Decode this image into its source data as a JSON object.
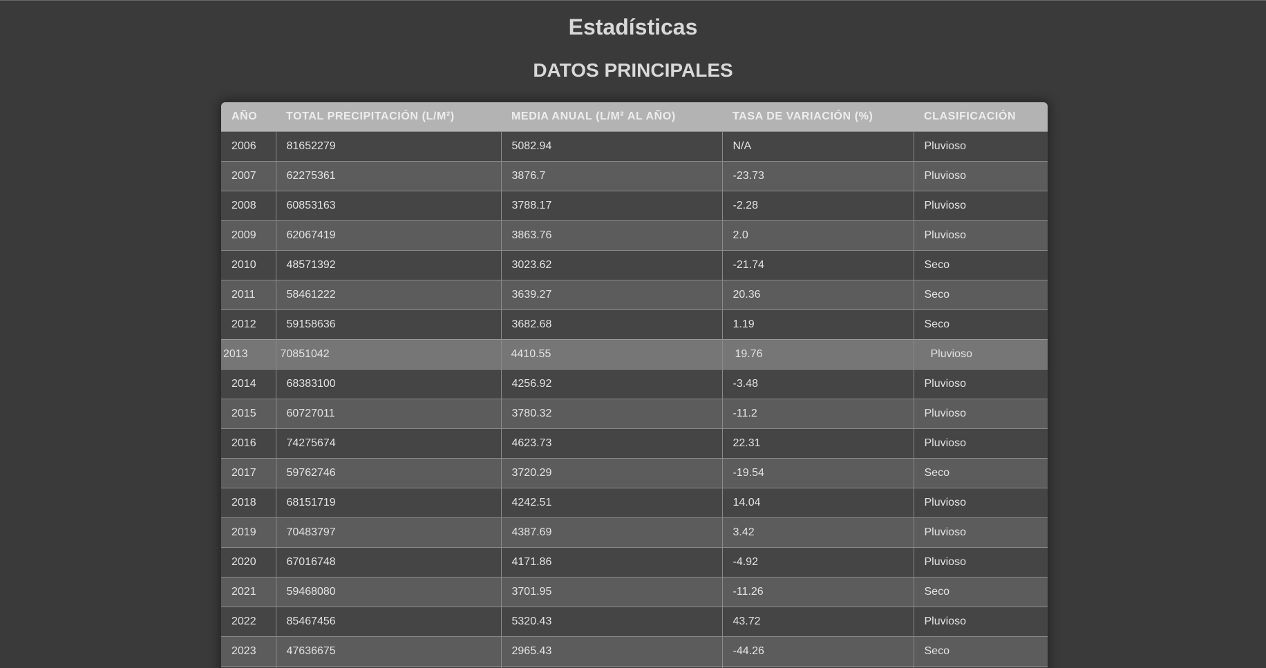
{
  "page": {
    "title": "Estadísticas",
    "subtitle": "DATOS PRINCIPALES"
  },
  "table": {
    "headers": [
      "AÑO",
      "TOTAL PRECIPITACIÓN (L/M²)",
      "MEDIA ANUAL (L/M² AL AÑO)",
      "TASA DE VARIACIÓN (%)",
      "CLASIFICACIÓN"
    ],
    "highlighted_row_year": "2013",
    "rows": [
      [
        "2006",
        "81652279",
        "5082.94",
        "N/A",
        "Pluvioso"
      ],
      [
        "2007",
        "62275361",
        "3876.7",
        "-23.73",
        "Pluvioso"
      ],
      [
        "2008",
        "60853163",
        "3788.17",
        "-2.28",
        "Pluvioso"
      ],
      [
        "2009",
        "62067419",
        "3863.76",
        "2.0",
        "Pluvioso"
      ],
      [
        "2010",
        "48571392",
        "3023.62",
        "-21.74",
        "Seco"
      ],
      [
        "2011",
        "58461222",
        "3639.27",
        "20.36",
        "Seco"
      ],
      [
        "2012",
        "59158636",
        "3682.68",
        "1.19",
        "Seco"
      ],
      [
        "2013",
        "70851042",
        "4410.55",
        "19.76",
        "Pluvioso"
      ],
      [
        "2014",
        "68383100",
        "4256.92",
        "-3.48",
        "Pluvioso"
      ],
      [
        "2015",
        "60727011",
        "3780.32",
        "-11.2",
        "Pluvioso"
      ],
      [
        "2016",
        "74275674",
        "4623.73",
        "22.31",
        "Pluvioso"
      ],
      [
        "2017",
        "59762746",
        "3720.29",
        "-19.54",
        "Seco"
      ],
      [
        "2018",
        "68151719",
        "4242.51",
        "14.04",
        "Pluvioso"
      ],
      [
        "2019",
        "70483797",
        "4387.69",
        "3.42",
        "Pluvioso"
      ],
      [
        "2020",
        "67016748",
        "4171.86",
        "-4.92",
        "Pluvioso"
      ],
      [
        "2021",
        "59468080",
        "3701.95",
        "-11.26",
        "Seco"
      ],
      [
        "2022",
        "85467456",
        "5320.43",
        "43.72",
        "Pluvioso"
      ],
      [
        "2023",
        "47636675",
        "2965.43",
        "-44.26",
        "Seco"
      ],
      [
        "",
        "",
        "",
        "",
        ""
      ]
    ]
  },
  "colors": {
    "background": "#3a3a3a",
    "header": "#b3b3b3",
    "row_dark": "#454545",
    "row_light": "#5c5c5c",
    "row_highlight": "#767676"
  }
}
